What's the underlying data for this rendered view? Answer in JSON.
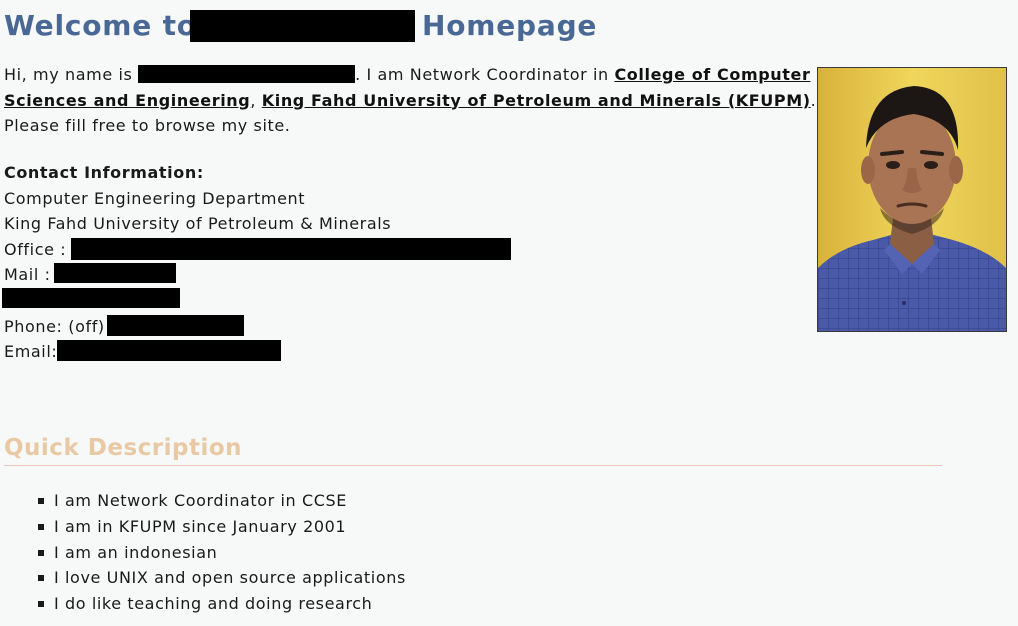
{
  "header": {
    "title_prefix": "Welcome to",
    "title_suffix": "Homepage"
  },
  "intro": {
    "greeting": "Hi, my name is",
    "role_text": ". I am Network Coordinator in",
    "college_link": "College of Computer Sciences and Engineering",
    "separator": ",",
    "university_link": "King Fahd University of Petroleum and Minerals (KFUPM)",
    "closing": ". Please fill free to browse my site."
  },
  "contact": {
    "heading": "Contact Information:",
    "department": "Computer Engineering Department",
    "university": "King Fahd University of Petroleum & Minerals",
    "office_label": "Office :",
    "mail_label": "Mail :",
    "phone_label": "Phone: (off)",
    "email_label": "Email:"
  },
  "quick_description": {
    "heading": "Quick Description",
    "items": [
      "I am Network Coordinator in CCSE",
      "I am in KFUPM since January 2001",
      "I am an indonesian",
      "I love UNIX and open source applications",
      "I do like teaching and doing research"
    ]
  },
  "colors": {
    "page_background": "#f7f8f8",
    "title": "#4a6895",
    "section_heading": "#e9c9a3",
    "heading_rule": "#efc6b9",
    "redaction": "#000000"
  },
  "icons": {
    "photo": "profile-photo"
  }
}
